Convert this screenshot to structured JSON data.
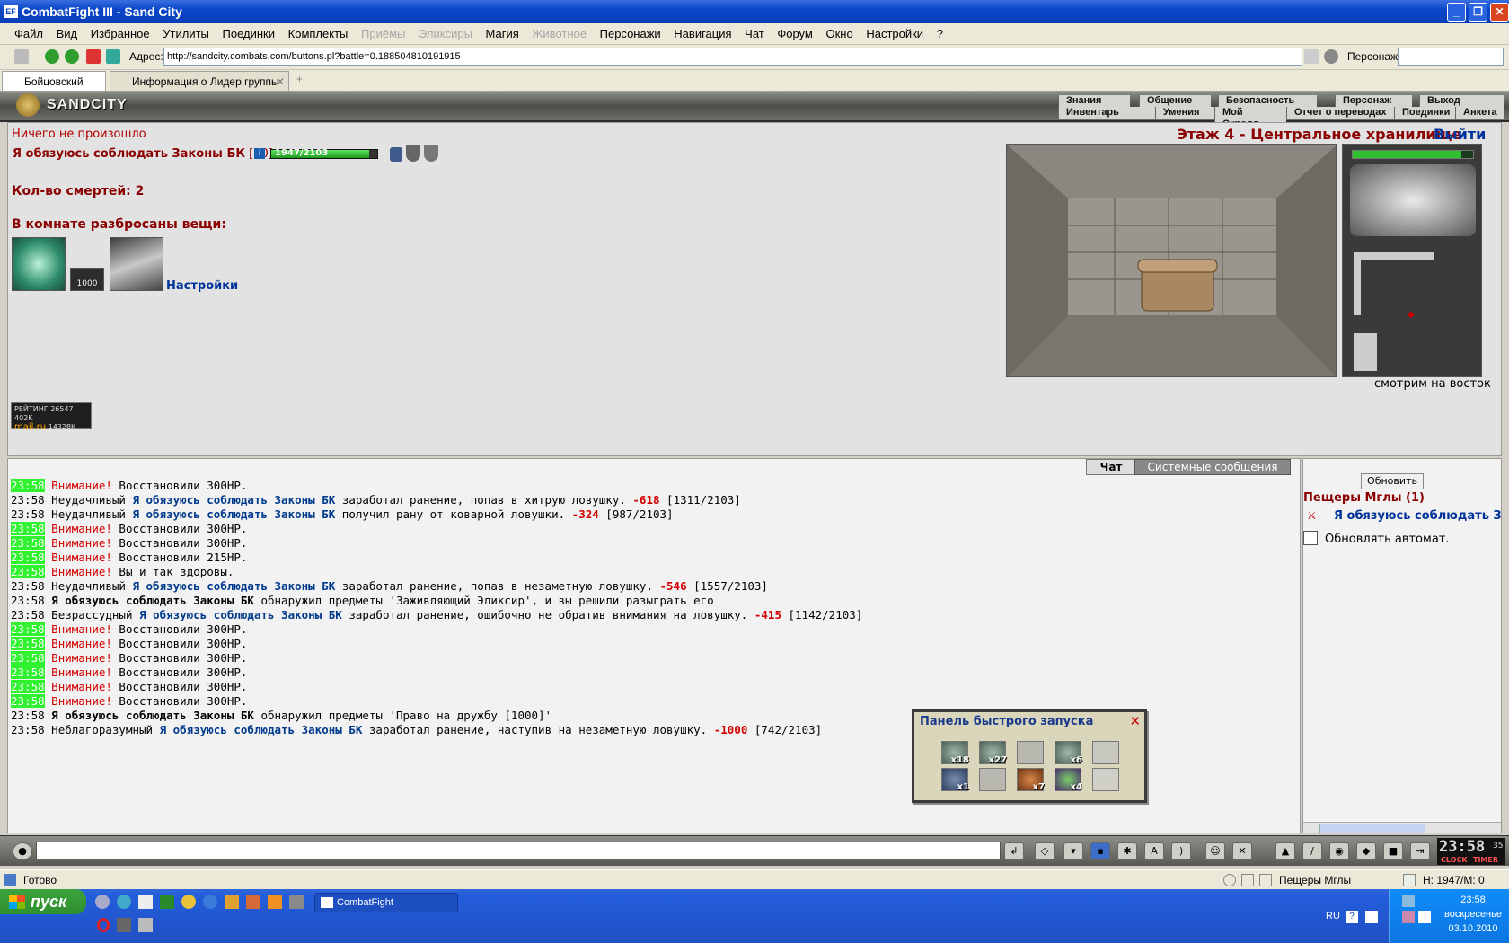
{
  "window": {
    "title": "CombatFight III - Sand City",
    "icon_text": "EF"
  },
  "menu": {
    "items": [
      "Файл",
      "Вид",
      "Избранное",
      "Утилиты",
      "Поединки",
      "Комплекты"
    ],
    "disabled1": "Приёмы",
    "disabled2": "Эликсиры",
    "magic": "Магия",
    "disabled3": "Животное",
    "items2": [
      "Персонажи",
      "Навигация",
      "Чат",
      "Форум",
      "Окно",
      "Настройки",
      "?"
    ]
  },
  "address": {
    "label": "Адрес:",
    "url": "http://sandcity.combats.com/buttons.pl?battle=0.188504810191915",
    "person_label": "Персонаж:"
  },
  "tabs": [
    {
      "label": "Бойцовский клуб"
    },
    {
      "label": "Информация о Лидер группы"
    }
  ],
  "game_nav": {
    "row1": [
      "Знания",
      "Общение",
      "Безопасность",
      "Персонаж",
      "Выход"
    ],
    "row2": [
      "Инвентарь",
      "Умения",
      "Мой Скролл",
      "Отчет о переводах",
      "Поединки",
      "Анкета"
    ],
    "logo": "SANDCITY"
  },
  "main": {
    "nothing_happened": "Ничего не произошло",
    "player_name": "Я обязуюсь соблюдать Законы БК",
    "player_level": "[10]",
    "hp_text": "1947/2103",
    "hp_fraction": 0.926,
    "deaths": "Кол-во смертей: 2",
    "items_heading": "В комнате разбросаны вещи:",
    "item_count_badge": "1000",
    "settings_link": "Настройки",
    "location_title": "Этаж 4 - Центральное хранилище",
    "exit_link": "Выйти",
    "direction": "смотрим на восток",
    "rating_line1": "РЕЙТИНГ",
    "rating_val1": "26547",
    "rating_val1b": "402K",
    "rating_mail": "mail.ru",
    "rating_val2": "14328K",
    "rating_val3": "41003"
  },
  "chat": {
    "tab_chat": "Чат",
    "tab_system": "Системные сообщения",
    "lines": [
      {
        "t": "23:58",
        "hl": true,
        "pre": "Внимание!",
        "mid": " Восстановили 300HP.",
        "name": "",
        "post": "",
        "dmg": "",
        "hp": ""
      },
      {
        "t": "23:58",
        "hl": false,
        "pre": "",
        "mid": "Неудачливый ",
        "name": "Я обязуюсь соблюдать Законы БК",
        "post": " заработал ранение, попав в хитрую ловушку. ",
        "dmg": "-618",
        "hp": " [1311/2103]"
      },
      {
        "t": "23:58",
        "hl": false,
        "pre": "",
        "mid": "Неудачливый ",
        "name": "Я обязуюсь соблюдать Законы БК",
        "post": " получил рану от коварной ловушки. ",
        "dmg": "-324",
        "hp": " [987/2103]"
      },
      {
        "t": "23:58",
        "hl": true,
        "pre": "Внимание!",
        "mid": " Восстановили 300HP.",
        "name": "",
        "post": "",
        "dmg": "",
        "hp": ""
      },
      {
        "t": "23:58",
        "hl": true,
        "pre": "Внимание!",
        "mid": " Восстановили 300HP.",
        "name": "",
        "post": "",
        "dmg": "",
        "hp": ""
      },
      {
        "t": "23:58",
        "hl": true,
        "pre": "Внимание!",
        "mid": " Восстановили 215HP.",
        "name": "",
        "post": "",
        "dmg": "",
        "hp": ""
      },
      {
        "t": "23:58",
        "hl": true,
        "pre": "Внимание!",
        "mid": " Вы и так здоровы.",
        "name": "",
        "post": "",
        "dmg": "",
        "hp": ""
      },
      {
        "t": "23:58",
        "hl": false,
        "pre": "",
        "mid": "Неудачливый ",
        "name": "Я обязуюсь соблюдать Законы БК",
        "post": " заработал ранение, попав в незаметную ловушку. ",
        "dmg": "-546",
        "hp": " [1557/2103]"
      },
      {
        "t": "23:58",
        "hl": false,
        "pre": "",
        "mid": "",
        "bold": "Я обязуюсь соблюдать Законы БК",
        "post": " обнаружил предметы 'Заживляющий Эликсир', и вы решили разыграть его",
        "name": "",
        "dmg": "",
        "hp": ""
      },
      {
        "t": "23:58",
        "hl": false,
        "pre": "",
        "mid": "Безрассудный ",
        "name": "Я обязуюсь соблюдать Законы БК",
        "post": " заработал ранение, ошибочно не обратив внимания на ловушку. ",
        "dmg": "-415",
        "hp": " [1142/2103]"
      },
      {
        "t": "23:58",
        "hl": true,
        "pre": "Внимание!",
        "mid": " Восстановили 300HP.",
        "name": "",
        "post": "",
        "dmg": "",
        "hp": ""
      },
      {
        "t": "23:58",
        "hl": true,
        "pre": "Внимание!",
        "mid": " Восстановили 300HP.",
        "name": "",
        "post": "",
        "dmg": "",
        "hp": ""
      },
      {
        "t": "23:58",
        "hl": true,
        "pre": "Внимание!",
        "mid": " Восстановили 300HP.",
        "name": "",
        "post": "",
        "dmg": "",
        "hp": ""
      },
      {
        "t": "23:58",
        "hl": true,
        "pre": "Внимание!",
        "mid": " Восстановили 300HP.",
        "name": "",
        "post": "",
        "dmg": "",
        "hp": ""
      },
      {
        "t": "23:58",
        "hl": true,
        "pre": "Внимание!",
        "mid": " Восстановили 300HP.",
        "name": "",
        "post": "",
        "dmg": "",
        "hp": ""
      },
      {
        "t": "23:58",
        "hl": true,
        "pre": "Внимание!",
        "mid": " Восстановили 300HP.",
        "name": "",
        "post": "",
        "dmg": "",
        "hp": ""
      },
      {
        "t": "23:58",
        "hl": false,
        "pre": "",
        "mid": "",
        "bold": "Я обязуюсь соблюдать Законы БК",
        "post": " обнаружил предметы 'Право на дружбу [1000]'",
        "name": "",
        "dmg": "",
        "hp": ""
      },
      {
        "t": "23:58",
        "hl": false,
        "pre": "",
        "mid": "Неблагоразумный ",
        "name": "Я обязуюсь соблюдать Законы БК",
        "post": " заработал ранение, наступив на незаметную ловушку. ",
        "dmg": "-1000",
        "hp": " [742/2103]"
      }
    ]
  },
  "right_panel": {
    "refresh": "Обновить",
    "location": "Пещеры Мглы (1)",
    "member": "Я обязуюсь соблюдать З",
    "auto_refresh": "Обновлять автомат."
  },
  "quick_panel": {
    "title": "Панель быстрого запуска",
    "row1": [
      "x18",
      "x27",
      "",
      "x6",
      ""
    ],
    "row2": [
      "x1",
      "",
      "x7",
      "x4",
      ""
    ]
  },
  "chatbar": {
    "clock": "23:58",
    "seconds": "35",
    "clock_label": "CLOCK",
    "timer_label": "TIMER"
  },
  "status": {
    "ready": "Готово",
    "zone": "Пещеры Мглы",
    "hpmp": "H: 1947/M: 0"
  },
  "taskbar": {
    "start": "пуск",
    "task": "CombatFight",
    "lang": "RU",
    "time": "23:58",
    "day": "воскресенье",
    "date": "03.10.2010"
  },
  "colors": {
    "accent": "#8b0000",
    "link": "#003399",
    "hp": "#2ec02e",
    "time_hl": "#2ef32e"
  }
}
